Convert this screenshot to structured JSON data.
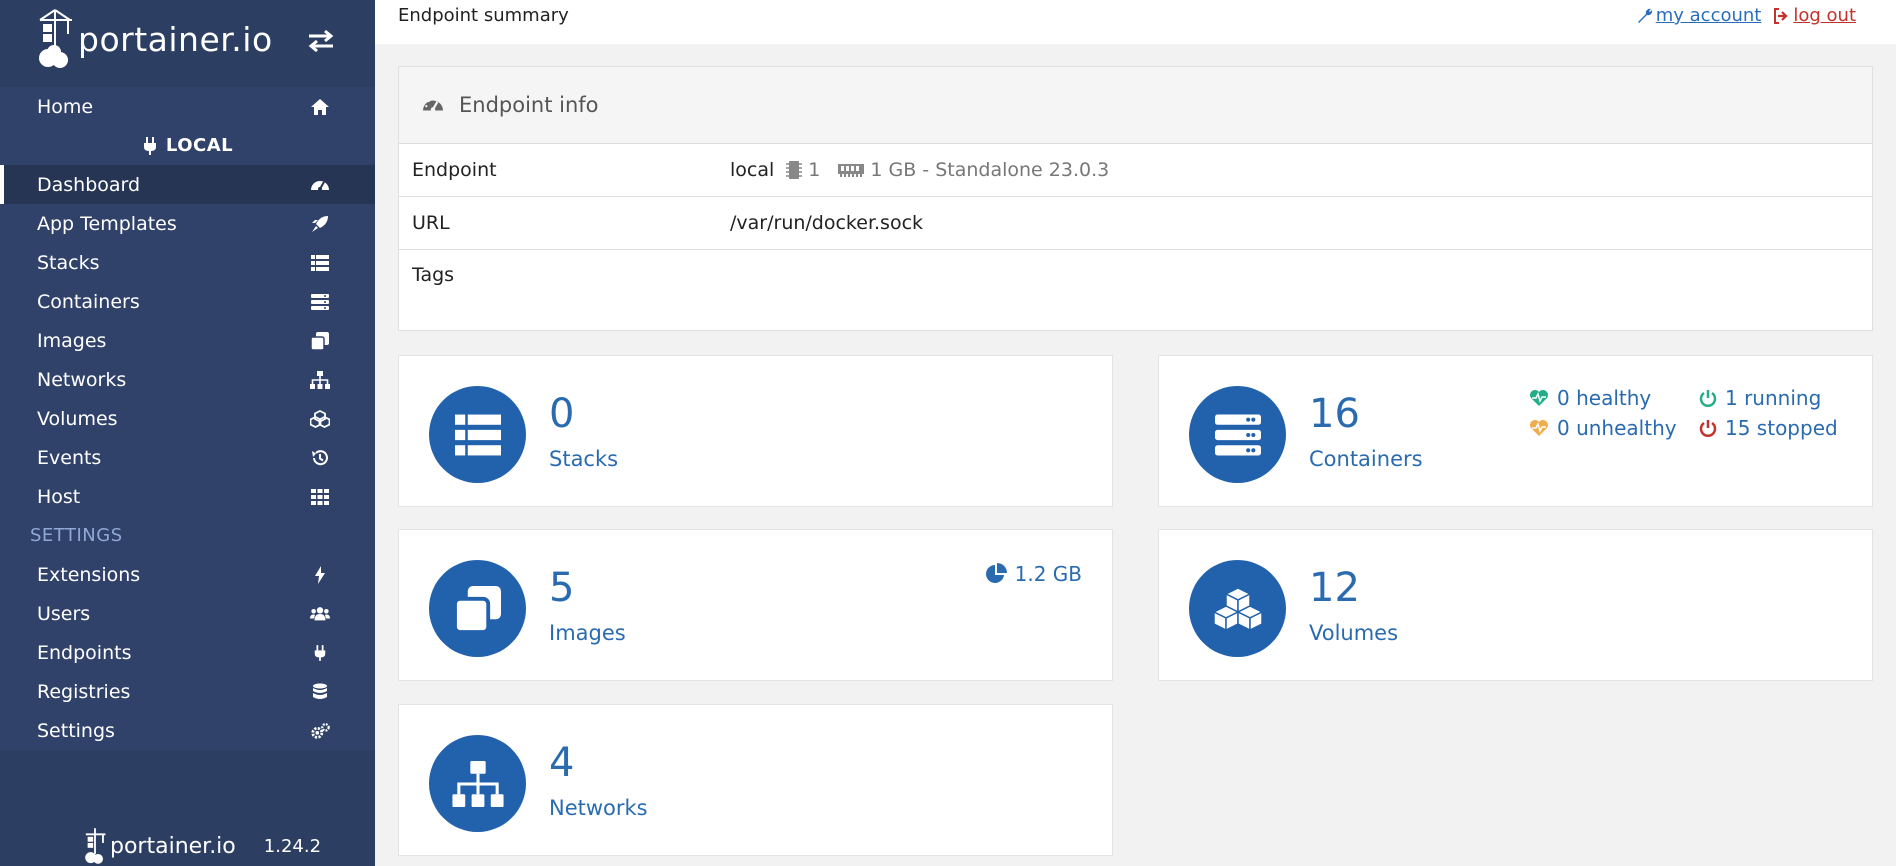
{
  "brand": {
    "name": "portainer.io",
    "version": "1.24.2"
  },
  "sidebar": {
    "home": "Home",
    "endpoint": "LOCAL",
    "items": [
      {
        "label": "Dashboard",
        "icon": "tachometer-icon"
      },
      {
        "label": "App Templates",
        "icon": "rocket-icon"
      },
      {
        "label": "Stacks",
        "icon": "th-list-icon"
      },
      {
        "label": "Containers",
        "icon": "server-icon"
      },
      {
        "label": "Images",
        "icon": "clone-icon"
      },
      {
        "label": "Networks",
        "icon": "sitemap-icon"
      },
      {
        "label": "Volumes",
        "icon": "cubes-icon"
      },
      {
        "label": "Events",
        "icon": "history-icon"
      },
      {
        "label": "Host",
        "icon": "th-icon"
      }
    ],
    "settings_heading": "SETTINGS",
    "settings_items": [
      {
        "label": "Extensions",
        "icon": "bolt-icon"
      },
      {
        "label": "Users",
        "icon": "users-icon"
      },
      {
        "label": "Endpoints",
        "icon": "plug-icon"
      },
      {
        "label": "Registries",
        "icon": "database-icon"
      },
      {
        "label": "Settings",
        "icon": "cogs-icon"
      }
    ]
  },
  "header": {
    "title": "Endpoint summary",
    "my_account": "my account",
    "log_out": "log out"
  },
  "endpoint_info": {
    "heading": "Endpoint info",
    "rows": {
      "endpoint_label": "Endpoint",
      "endpoint_name": "local",
      "cpu": "1",
      "memory_details": "1 GB - Standalone 23.0.3",
      "url_label": "URL",
      "url_value": "/var/run/docker.sock",
      "tags_label": "Tags"
    }
  },
  "tiles": {
    "stacks": {
      "count": "0",
      "label": "Stacks"
    },
    "containers": {
      "count": "16",
      "label": "Containers",
      "healthy": "0 healthy",
      "running": "1 running",
      "unhealthy": "0 unhealthy",
      "stopped": "15 stopped"
    },
    "images": {
      "count": "5",
      "label": "Images",
      "size": "1.2 GB"
    },
    "volumes": {
      "count": "12",
      "label": "Volumes"
    },
    "networks": {
      "count": "4",
      "label": "Networks"
    }
  },
  "colors": {
    "sidebar_bg": "#2d3e63",
    "accent_blue": "#2262ad",
    "healthy_green": "#23ae89",
    "unhealthy_orange": "#f0ad4e",
    "stopped_red": "#c4312b"
  }
}
